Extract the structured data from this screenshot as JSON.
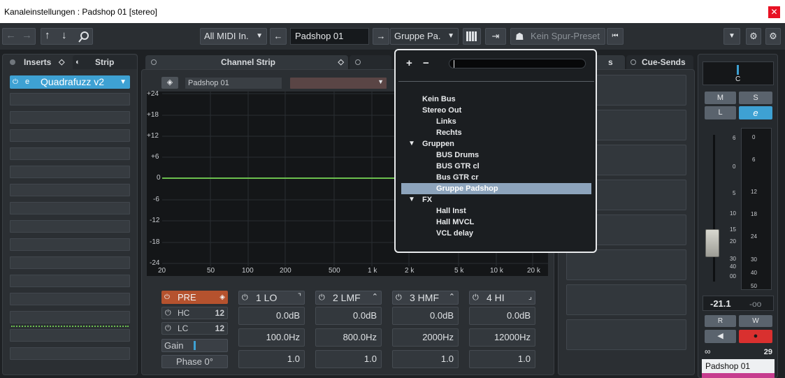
{
  "window": {
    "title": "Kanaleinstellungen : Padshop 01 [stereo]",
    "close": "✕"
  },
  "toolbar": {
    "midi_input": "All MIDI In.",
    "track_name": "Padshop 01",
    "output_routing": "Gruppe Pa.",
    "preset": "Kein Spur-Preset"
  },
  "left_tabs": {
    "inserts": "Inserts",
    "strip": "Strip"
  },
  "inserts": {
    "slot1": "Quadrafuzz v2"
  },
  "channel_strip": {
    "tab": "Channel Strip",
    "eq_name": "Padshop 01",
    "y_ticks": [
      "+24",
      "+18",
      "+12",
      "+6",
      "0",
      "-6",
      "-12",
      "-18",
      "-24"
    ],
    "x_ticks": [
      "20",
      "50",
      "100",
      "200",
      "500",
      "1 k",
      "2 k",
      "5 k",
      "10 k",
      "20 k"
    ]
  },
  "eq_controls": {
    "pre": "PRE",
    "hc": "HC",
    "lc": "LC",
    "gain": "Gain",
    "phase": "Phase 0°",
    "bands": [
      {
        "label": "1 LO",
        "gain": "0.0dB",
        "freq": "100.0Hz",
        "q": "1.0"
      },
      {
        "label": "2 LMF",
        "gain": "0.0dB",
        "freq": "800.0Hz",
        "q": "1.0"
      },
      {
        "label": "3 HMF",
        "gain": "0.0dB",
        "freq": "2000Hz",
        "q": "1.0"
      },
      {
        "label": "4 HI",
        "gain": "0.0dB",
        "freq": "12000Hz",
        "q": "1.0"
      }
    ]
  },
  "right_tabs": {
    "sends_suffix": "s",
    "cue_sends": "Cue-Sends"
  },
  "routing_popup": {
    "plus": "+",
    "minus": "−",
    "items": [
      {
        "label": "Kein Bus",
        "level": 0
      },
      {
        "label": "Stereo Out",
        "level": 0
      },
      {
        "label": "Links",
        "level": 1
      },
      {
        "label": "Rechts",
        "level": 1
      },
      {
        "label": "Gruppen",
        "level": 0,
        "folder": true
      },
      {
        "label": "BUS Drums",
        "level": 1
      },
      {
        "label": "BUS GTR cl",
        "level": 1
      },
      {
        "label": "Bus GTR cr",
        "level": 1
      },
      {
        "label": "Gruppe Padshop",
        "level": 1,
        "selected": true
      },
      {
        "label": "FX",
        "level": 0,
        "folder": true
      },
      {
        "label": "Hall Inst",
        "level": 1
      },
      {
        "label": "Hall MVCL",
        "level": 1
      },
      {
        "label": "VCL delay",
        "level": 1
      }
    ]
  },
  "fader_strip": {
    "pan": "C",
    "m": "M",
    "s": "S",
    "l": "L",
    "e": "e",
    "fader_scale": [
      "6",
      "0",
      "5",
      "10",
      "15",
      "20",
      "30",
      "40",
      "00"
    ],
    "meter_scale": [
      "0",
      "6",
      "12",
      "18",
      "24",
      "30",
      "40",
      "50"
    ],
    "volume": "-21.1",
    "peak": "-oo",
    "r": "R",
    "w": "W",
    "link_count": "29",
    "track_name": "Padshop 01"
  },
  "colors": {
    "accent": "#3ea1d3",
    "eq_line": "#6bbf4e",
    "pre": "#b5522e",
    "record": "#d9302f",
    "selected": "#8da4bc"
  }
}
